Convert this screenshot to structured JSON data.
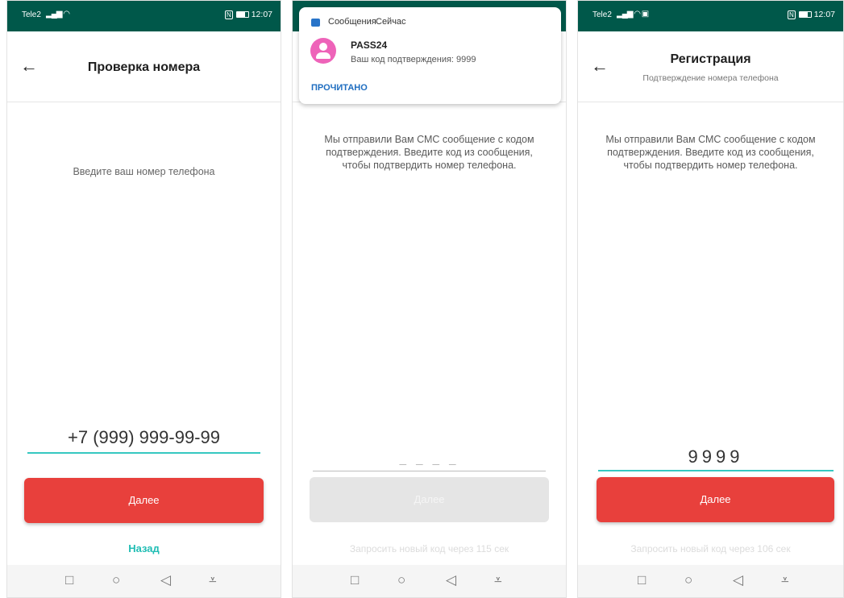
{
  "status": {
    "carrier": "Tele2",
    "time": "12:07"
  },
  "screen1": {
    "title": "Проверка номера",
    "hint": "Введите ваш номер телефона",
    "phone_value": "+7 (999) 999-99-99",
    "next_label": "Далее",
    "back_label": "Назад"
  },
  "screen2": {
    "notification": {
      "app": "Сообщения",
      "time": "Сейчас",
      "sender": "PASS24",
      "body": "Ваш код подтверждения: 9999",
      "action": "ПРОЧИТАНО"
    },
    "hint": "Мы отправили Вам СМС сообщение с кодом подтверждения. Введите код из сообщения, чтобы подтвердить номер телефона.",
    "code_placeholder": "_ _ _ _",
    "next_label": "Далее",
    "resend": "Запросить новый код через 115 сек"
  },
  "screen3": {
    "title": "Регистрация",
    "subtitle": "Подтверждение номера телефона",
    "hint": "Мы отправили Вам СМС сообщение с кодом подтверждения. Введите код из сообщения, чтобы подтвердить номер телефона.",
    "code_value": "9999",
    "next_label": "Далее",
    "resend": "Запросить новый код через 106 сек"
  },
  "nav": {
    "square": "□",
    "circle": "○",
    "triangle": "◁",
    "menu": "⩡"
  },
  "colors": {
    "statusbar": "#00584a",
    "accent_red": "#e8403c",
    "accent_teal": "#20bdb4",
    "notification_blue": "#1e6dc0"
  }
}
